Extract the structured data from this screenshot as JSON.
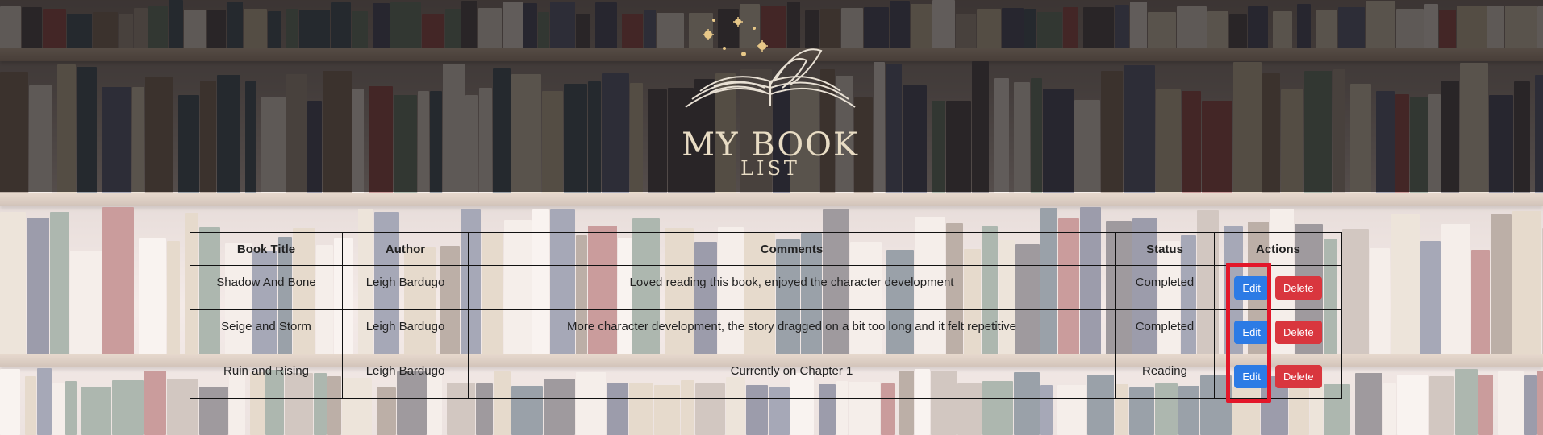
{
  "logo": {
    "line1": "MY BOOK",
    "line2": "LIST"
  },
  "table": {
    "headers": [
      "Book Title",
      "Author",
      "Comments",
      "Status",
      "Actions"
    ],
    "rows": [
      {
        "title": "Shadow And Bone",
        "author": "Leigh Bardugo",
        "comments": "Loved reading this book, enjoyed the character development",
        "status": "Completed"
      },
      {
        "title": "Seige and Storm",
        "author": "Leigh Bardugo",
        "comments": "More character development, the story dragged on a bit too long and it felt repetitive",
        "status": "Completed"
      },
      {
        "title": "Ruin and Rising",
        "author": "Leigh Bardugo",
        "comments": "Currently on Chapter 1",
        "status": "Reading"
      }
    ],
    "edit_label": "Edit",
    "delete_label": "Delete"
  },
  "colors": {
    "edit": "#2c7be5",
    "delete": "#d9363e",
    "highlight": "#e3172a"
  }
}
